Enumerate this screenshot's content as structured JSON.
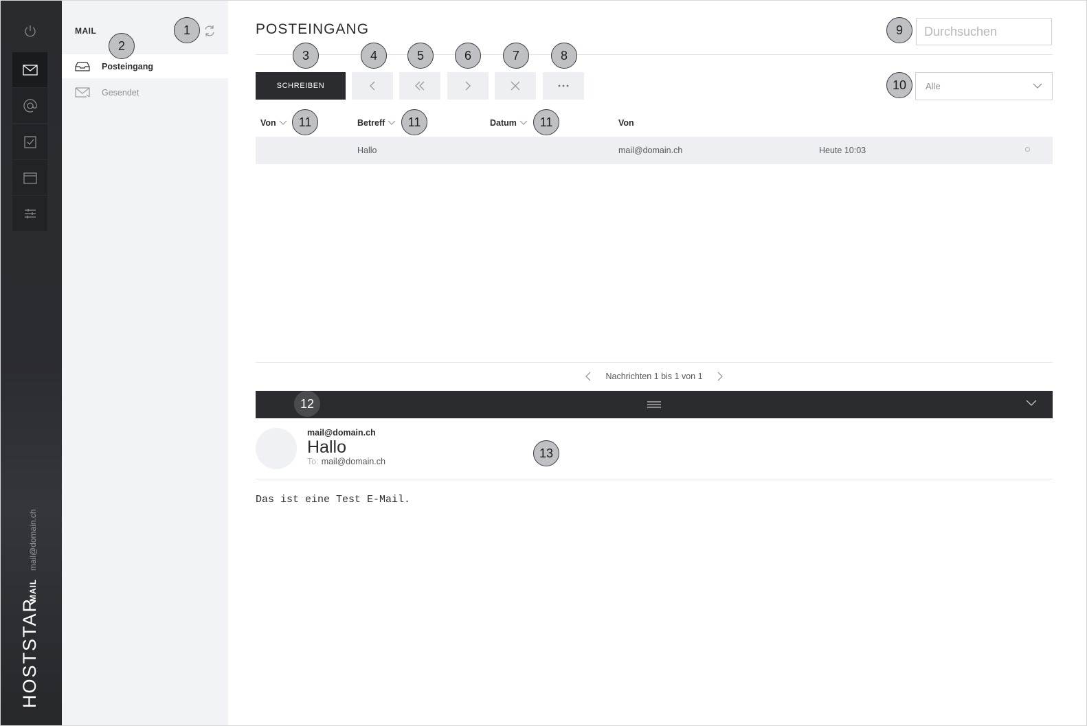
{
  "rail": {
    "brand": "HOSTSTAR",
    "app_label": "MAIL",
    "user": "mail@domain.ch"
  },
  "folders": {
    "title": "MAIL",
    "items": [
      {
        "label": "Posteingang",
        "icon": "inbox-icon",
        "active": true
      },
      {
        "label": "Gesendet",
        "icon": "sent-icon",
        "active": false
      }
    ]
  },
  "main": {
    "title": "POSTEINGANG",
    "search_placeholder": "Durchsuchen",
    "compose_label": "SCHREIBEN",
    "filter_value": "Alle",
    "columns": [
      "Von",
      "Betreff",
      "Datum",
      "Von"
    ],
    "messages": [
      {
        "from": "",
        "subject": "Hallo",
        "address": "mail@domain.ch",
        "date": "Heute 10:03"
      }
    ],
    "pager_text": "Nachrichten 1 bis 1 von 1"
  },
  "preview": {
    "sender": "mail@domain.ch",
    "subject": "Hallo",
    "to_label": "To:",
    "to": "mail@domain.ch",
    "body": "Das ist eine Test E-Mail."
  },
  "callouts": [
    "1",
    "2",
    "3",
    "4",
    "5",
    "6",
    "7",
    "8",
    "9",
    "10",
    "11",
    "11",
    "11",
    "12",
    "13"
  ],
  "colors": {
    "dark": "#2b2c30",
    "panel": "#f2f3f6",
    "row": "#eeeff2"
  }
}
